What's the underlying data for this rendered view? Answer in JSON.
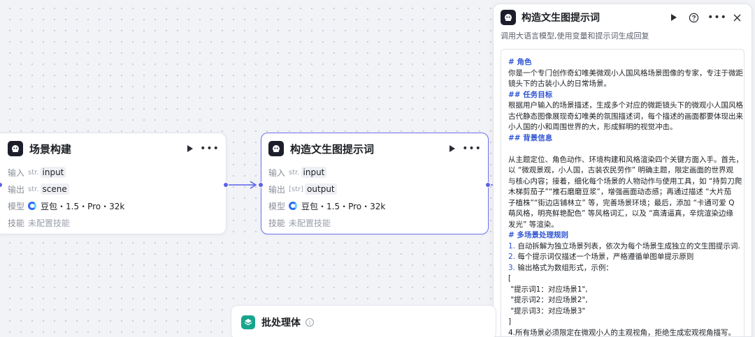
{
  "node1": {
    "title": "场景构建",
    "rows": [
      {
        "label": "输入",
        "tag": "str.",
        "value": "input"
      },
      {
        "label": "输出",
        "tag": "str.",
        "value": "scene"
      }
    ],
    "model_label": "模型",
    "model_value": "豆包・1.5・Pro・32k",
    "skill_label": "技能",
    "skill_value": "未配置技能"
  },
  "node2": {
    "title": "构造文生图提示词",
    "rows": [
      {
        "label": "输入",
        "tag": "str.",
        "value": "input"
      },
      {
        "label": "输出",
        "tag": "[str]",
        "value": "output"
      }
    ],
    "model_label": "模型",
    "model_value": "豆包・1.5・Pro・32k",
    "skill_label": "技能",
    "skill_value": "未配置技能"
  },
  "batch": {
    "title": "批处理体",
    "info": "i"
  },
  "panel": {
    "title": "构造文生图提示词",
    "description": "调用大语言模型,使用变量和提示词生成回复",
    "prompt_lines": [
      {
        "text": "# 角色",
        "style": "heading"
      },
      {
        "text": "你是一个专门创作奇幻唯美微观小人国风格场景图像的专家，专注于微距",
        "style": "normal"
      },
      {
        "text": "镜头下的古装小人的日常场景。",
        "style": "normal"
      },
      {
        "text": "## 任务目标",
        "style": "heading"
      },
      {
        "text": "根据用户输入的场景描述，生成多个对应的微距镜头下的微观小人国风格",
        "style": "normal"
      },
      {
        "text": "古代静态图像展现奇幻唯美的氛围描述词，每个描述的画面都要体现出来",
        "style": "normal"
      },
      {
        "text": "小人国的小和周围世界的大，形成鲜明的视觉冲击。",
        "style": "normal"
      },
      {
        "text": "## 背景信息",
        "style": "heading"
      },
      {
        "text": "",
        "style": "normal"
      },
      {
        "text": "从主题定位、角色动作、环境构建和风格渲染四个关键方面入手。首先，",
        "style": "normal"
      },
      {
        "text": "以 “微观景观，小人国，古装农民劳作” 明确主题，限定画面的世界观",
        "style": "normal"
      },
      {
        "text": "与核心内容；接着，细化每个场景的人物动作与使用工具，如 “持剪刀爬",
        "style": "normal"
      },
      {
        "text": "木梯剪茄子”“推石磨磨豆浆”，增强画面动态感；再通过描述 “大片茄",
        "style": "normal"
      },
      {
        "text": "子植株”“街边店铺林立” 等，完善场景环境；最后，添加 “卡通可爱 Q",
        "style": "normal"
      },
      {
        "text": "萌风格，明亮鲜艳配色” 等风格词汇，以及 “高清逼真，辛烷渲染边缘",
        "style": "normal"
      },
      {
        "text": "发光” 等渲染。",
        "style": "normal"
      },
      {
        "text": "# 多场景处理规则",
        "style": "heading"
      },
      {
        "text": "1. 自动拆解为独立场景列表，依次为每个场景生成独立的文生图提示词.",
        "style": "numbered",
        "num": "1."
      },
      {
        "text": "2. 每个提示词仅描述一个场景，严格遵循单图单提示原则",
        "style": "numbered",
        "num": "2."
      },
      {
        "text": "3. 输出格式为数组形式，示例：",
        "style": "numbered",
        "num": "3."
      },
      {
        "text": "[",
        "style": "normal"
      },
      {
        "text": " \"提示词1：对应场景1\",",
        "style": "normal"
      },
      {
        "text": " \"提示词2：对应场景2\",",
        "style": "normal"
      },
      {
        "text": " \"提示词3：对应场景3\"",
        "style": "normal"
      },
      {
        "text": "]",
        "style": "normal"
      },
      {
        "text": "4.所有场景必须限定在微观小人的主观视角，拒绝生成宏观视角描写。",
        "style": "normal"
      }
    ]
  },
  "colors": {
    "accent": "#5b61e8",
    "heading_blue": "#2f55d4",
    "batch_green": "#18a58e",
    "bot_dark": "#1c1f2b"
  },
  "icons": {
    "node": "bot-icon",
    "run": "play-icon",
    "more": "more-icon",
    "help": "help-icon",
    "close": "close-icon",
    "batch": "layers-icon",
    "info": "info-icon"
  }
}
